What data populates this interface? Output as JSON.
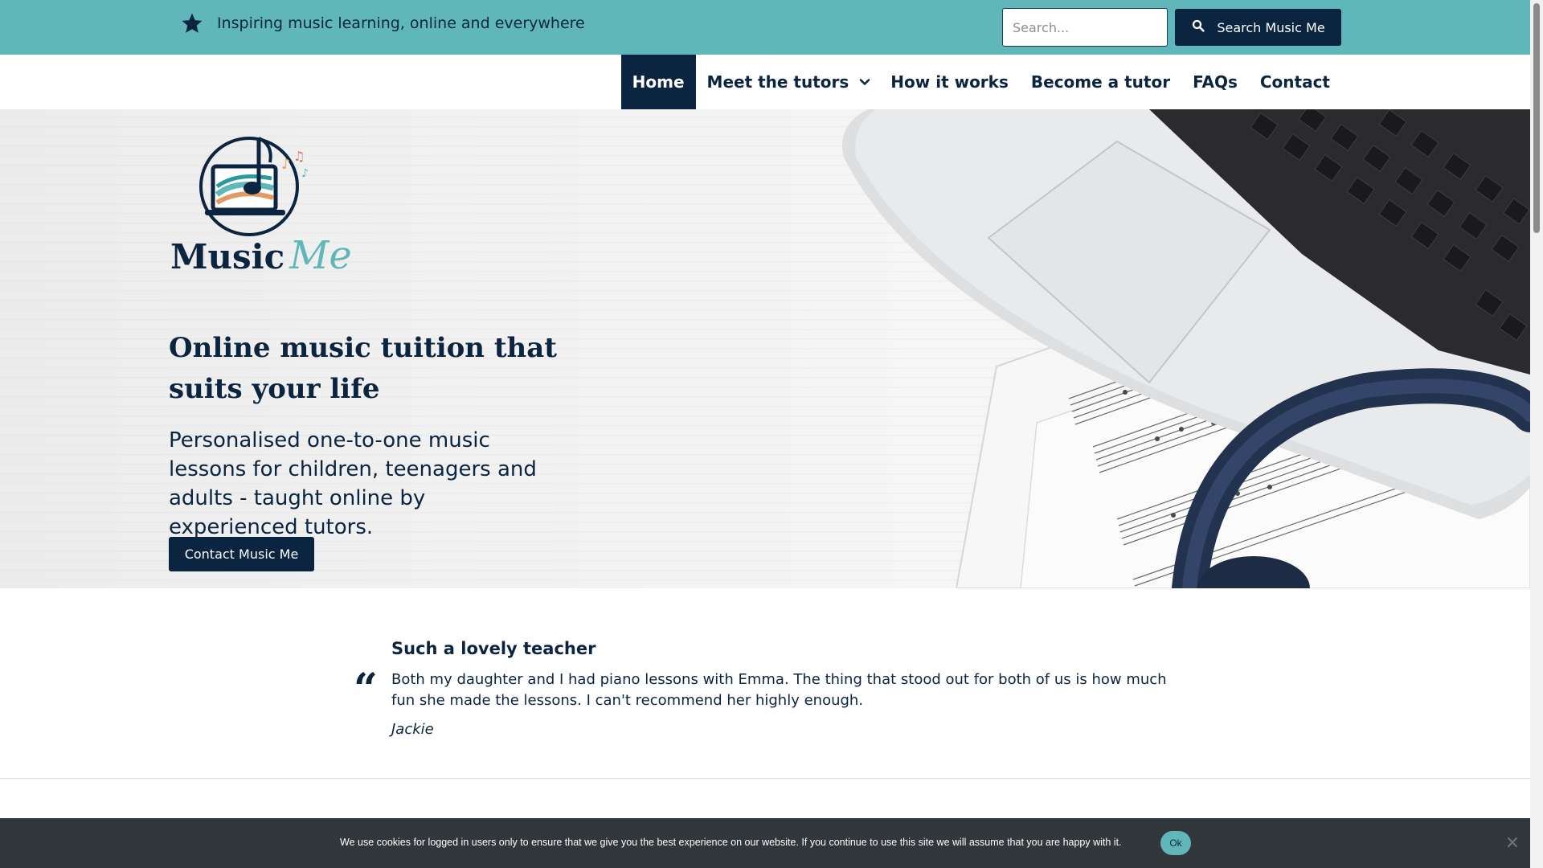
{
  "topbar": {
    "tagline": "Inspiring music learning, online and everywhere",
    "tagline_icon": "star-icon",
    "search_placeholder": "Search...",
    "search_button_label": "Search Music Me",
    "search_icon": "magnifier-icon",
    "background_color": "#5fb7b9"
  },
  "nav": {
    "items": [
      {
        "label": "Home",
        "active": true
      },
      {
        "label": "Meet the tutors",
        "active": false
      },
      {
        "label": "How it works",
        "active": false
      },
      {
        "label": "Become a tutor",
        "active": false
      },
      {
        "label": "FAQs",
        "active": false
      },
      {
        "label": "Contact",
        "active": false
      }
    ],
    "dropdown_icon": "chevron-down-icon",
    "active_color": "#0b2440"
  },
  "hero": {
    "logo_text_primary": "Music",
    "logo_text_script": "Me",
    "title": "Online music tuition that suits your life",
    "subtitle": "Personalised one-to-one music lessons for children, teenagers and adults - taught online by experienced tutors.",
    "button_label": "Contact Music Me"
  },
  "testimonial": {
    "title": "Such a lovely teacher",
    "body": "Both my daughter and I had piano lessons with Emma. The thing that stood out for both of us is how much fun she made the lessons. I can't recommend her highly enough.",
    "author": "Jackie",
    "quote_mark": "“"
  },
  "cookie": {
    "text": "We use cookies for logged in users only to ensure that we give you the best experience on our website. If you continue to use this site we will assume that you are happy with it.",
    "ok_label": "Ok",
    "close_icon": "close-icon"
  },
  "colors": {
    "navy": "#0b2440",
    "teal": "#5fb7b9",
    "cookie_bar": "#32373c"
  }
}
